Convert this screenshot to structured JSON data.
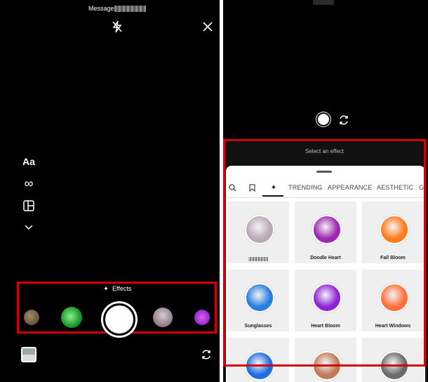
{
  "left_panel": {
    "header_title": "Message",
    "effects_label": "Effects",
    "side_tools": {
      "text_tool": "Aa"
    }
  },
  "right_panel": {
    "select_effect_label": "Select an effect",
    "tabs": [
      "TRENDING",
      "APPEARANCE",
      "AESTHETIC",
      "GA"
    ],
    "effects": [
      {
        "label": "",
        "color": "#b9a9b4"
      },
      {
        "label": "Doodle Heart",
        "color": "#9c27b0"
      },
      {
        "label": "Fall Bloom",
        "color": "#ff7a1a"
      },
      {
        "label": "Sunglasses",
        "color": "#2a7de1"
      },
      {
        "label": "Heart Bloom",
        "color": "#8e24d6"
      },
      {
        "label": "Heart Windows",
        "color": "#ff6f3c"
      },
      {
        "label": "",
        "color": "#1f6fe0"
      },
      {
        "label": "",
        "color": "#c07a5a"
      },
      {
        "label": "",
        "color": "#6b6b6b"
      }
    ]
  },
  "colors": {
    "highlight_border": "#d40000",
    "background": "#000000"
  }
}
